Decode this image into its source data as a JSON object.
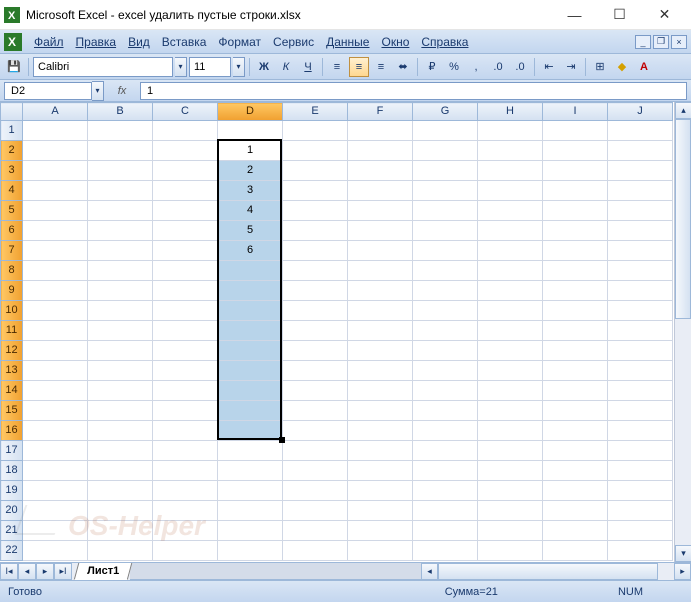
{
  "window": {
    "title": "Microsoft Excel - excel удалить пустые строки.xlsx"
  },
  "menu": {
    "items": [
      "Файл",
      "Правка",
      "Вид",
      "Вставка",
      "Формат",
      "Сервис",
      "Данные",
      "Окно",
      "Справка"
    ]
  },
  "toolbar": {
    "font": "Calibri",
    "fontSize": "11",
    "bold": "Ж",
    "italic": "К",
    "underline": "Ч"
  },
  "formulaBar": {
    "nameBox": "D2",
    "fxLabel": "fx",
    "formula": "1"
  },
  "grid": {
    "columns": [
      "A",
      "B",
      "C",
      "D",
      "E",
      "F",
      "G",
      "H",
      "I",
      "J"
    ],
    "rowCount": 22,
    "activeCell": "D2",
    "selectionColumn": "D",
    "selectionStartRow": 2,
    "selectionEndRow": 16,
    "cells": {
      "D2": "1",
      "D3": "2",
      "D4": "3",
      "D5": "4",
      "D6": "5",
      "D7": "6"
    }
  },
  "sheets": {
    "active": "Лист1"
  },
  "statusBar": {
    "ready": "Готово",
    "sum": "Сумма=21",
    "numLock": "NUM"
  },
  "watermark": "OS-Helper"
}
